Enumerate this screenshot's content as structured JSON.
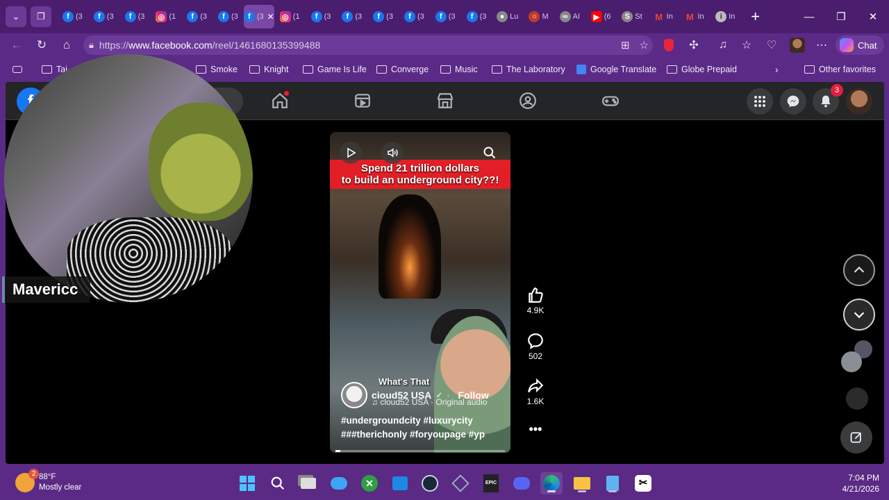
{
  "browser": {
    "tabs": [
      {
        "icon": "facebook",
        "label": "(3"
      },
      {
        "icon": "facebook",
        "label": "(3"
      },
      {
        "icon": "facebook",
        "label": "(3"
      },
      {
        "icon": "instagram",
        "label": "(1"
      },
      {
        "icon": "facebook",
        "label": "(3"
      },
      {
        "icon": "facebook",
        "label": "(3"
      },
      {
        "icon": "facebook",
        "label": "(3",
        "active": true
      },
      {
        "icon": "instagram",
        "label": "(1"
      },
      {
        "icon": "facebook",
        "label": "(3"
      },
      {
        "icon": "facebook",
        "label": "(3"
      },
      {
        "icon": "facebook",
        "label": "(3"
      },
      {
        "icon": "facebook",
        "label": "(3"
      },
      {
        "icon": "facebook",
        "label": "(3"
      },
      {
        "icon": "facebook",
        "label": "(3"
      },
      {
        "icon": "app",
        "label": "Lu"
      },
      {
        "icon": "opera",
        "label": "M"
      },
      {
        "icon": "ai",
        "label": "AI"
      },
      {
        "icon": "youtube",
        "label": "(6"
      },
      {
        "icon": "st",
        "label": "St"
      },
      {
        "icon": "gmail",
        "label": "In"
      },
      {
        "icon": "gmail",
        "label": "In"
      },
      {
        "icon": "info",
        "label": "In"
      }
    ],
    "url_prefix": "https://",
    "url_domain": "www.facebook.com",
    "url_path": "/reel/1461680135399488",
    "chat_label": "Chat"
  },
  "bookmarks": [
    "Tai",
    "Smoke",
    "Knight",
    "Game Is Life",
    "Converge",
    "Music",
    "The Laboratory",
    "Google Translate",
    "Globe Prepaid",
    "Other favorites"
  ],
  "facebook": {
    "notifications_count": "3"
  },
  "reel": {
    "caption_line1": "Spend 21 trillion dollars",
    "caption_line2": "to build an underground city??!",
    "overlay_text": "What's That",
    "author": "cioud52 USA",
    "follow_label": "Follow",
    "audio": "♫ cloud52 USA · Original audio",
    "hashtags": "#undergroundcity #luxurycity ###therichonly #foryoupage #yp",
    "likes": "4.9K",
    "comments": "502",
    "shares": "1.6K",
    "progress": 0.03
  },
  "webcam": {
    "name": "Mavericc"
  },
  "taskbar": {
    "weather_badge": "2",
    "temperature": "88°F",
    "condition": "Mostly clear",
    "time": "7:04 PM",
    "date": "4/21/2026"
  },
  "colors": {
    "browser_frame": "#5b2a86",
    "facebook_blue": "#1877f2",
    "caption_red": "#e21f26",
    "notification_red": "#e41e3f"
  }
}
